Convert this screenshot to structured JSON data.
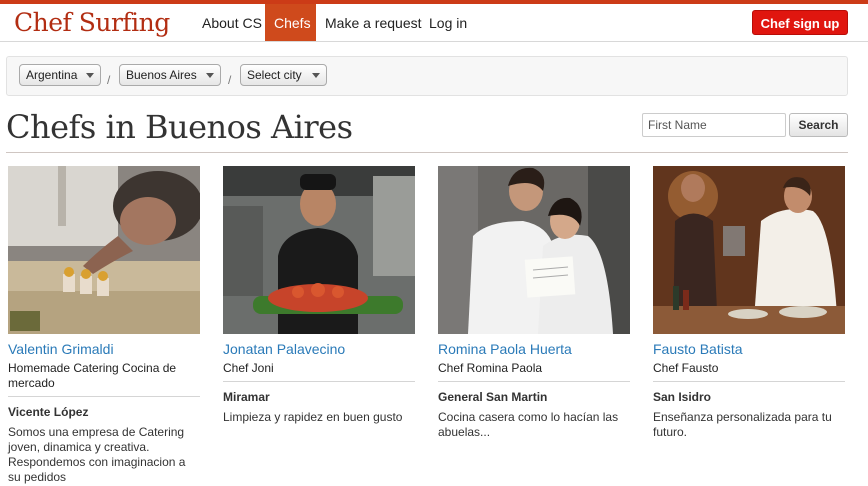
{
  "brand": {
    "logo_text": "Chef Surfing"
  },
  "nav": {
    "items": [
      {
        "label": "About CS",
        "active": false
      },
      {
        "label": "Chefs",
        "active": true
      },
      {
        "label": "Make a request",
        "active": false
      },
      {
        "label": "Log in",
        "active": false
      }
    ],
    "signup_label": "Chef sign up"
  },
  "filters": {
    "country": "Argentina",
    "region": "Buenos Aires",
    "city": "Select city",
    "separator": "/"
  },
  "page": {
    "title": "Chefs in Buenos Aires",
    "search_placeholder": "First Name",
    "search_button": "Search"
  },
  "chefs": [
    {
      "name": "Valentin Grimaldi",
      "business": "Homemade Catering Cocina de mercado",
      "location": "Vicente López",
      "description": "Somos una empresa de Catering joven, dinamica y creativa. Respondemos con imaginacion a su pedidos"
    },
    {
      "name": "Jonatan Palavecino",
      "business": "Chef Joni",
      "location": "Miramar",
      "description": "Limpieza y rapidez en buen gusto"
    },
    {
      "name": "Romina Paola Huerta",
      "business": "Chef Romina Paola",
      "location": "General San Martin",
      "description": "Cocina casera como lo hacían las abuelas..."
    },
    {
      "name": "Fausto Batista",
      "business": "Chef Fausto",
      "location": "San Isidro",
      "description": "Enseñanza personalizada para tu futuro."
    }
  ],
  "colors": {
    "brand_red": "#b22d12",
    "nav_active": "#cf4a1c",
    "signup": "#e0160f",
    "link": "#2a7ab8"
  }
}
